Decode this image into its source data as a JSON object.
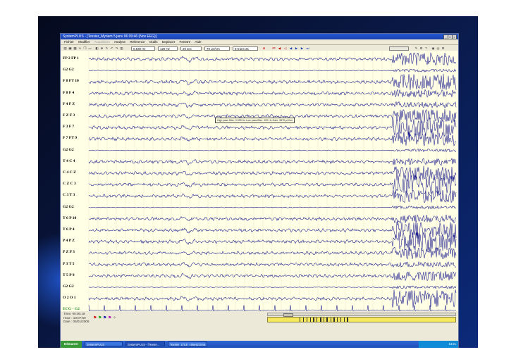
{
  "window": {
    "title": "SystemPLUS - [Texsier_Myriam 5 janv 06 09:46 (Nov EEG)]",
    "menu": [
      "Fichier",
      "Modifier",
      "Acquisition",
      "Analyse",
      "Reference",
      "Outils",
      "Deplacer",
      "Fenetre",
      "Aide"
    ],
    "toolbar": {
      "high_pass": "0,530 Hz",
      "low_pass": "120 Hz",
      "timebase": "20 sec",
      "sensitivity": "70 µV/cm",
      "montage": "6-trans-21"
    }
  },
  "channels": [
    "FP 2 FP 1",
    "G2 G2",
    "F 8 FT 10",
    "F 8 F 4",
    "F 4 F Z",
    "F Z F 3",
    "F 3 F 7",
    "F 7 FT 9",
    "G2 G2",
    "T 4 C 4",
    "C 4 C Z",
    "C Z C 3",
    "C 3 T 3",
    "G2 G2",
    "T 6 P 10",
    "T 6 P 4",
    "P 4 P Z",
    "P Z P 3",
    "P 3 T 5",
    "T 5 P 9",
    "G2 G2",
    "O 2 O 1",
    "ECG - G2"
  ],
  "tooltip": "High pass filter: 0.530 Hz    Low pass filter: 120 Hz    Gain: 3870 µV/cm",
  "status": {
    "time": "Time: 00:00:19",
    "hour": "Hour : 10:07:50",
    "date": "Date : 05/01/2006"
  },
  "taskbar": {
    "start": "Démarrer",
    "items": [
      "SystemPLUS",
      "SystemPLUS - [Texsie...",
      "Texsier_LTLE_crises2.bmp..."
    ],
    "clock": "13:21"
  },
  "colors": {
    "trace": "#14148c",
    "ecg_label": "#2e8b2e",
    "eeg_background": "#ffffe6"
  }
}
